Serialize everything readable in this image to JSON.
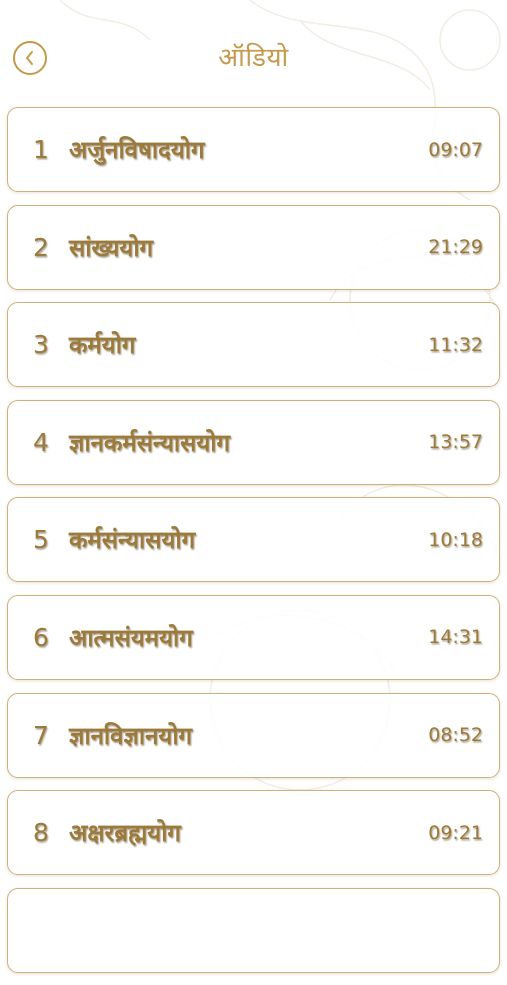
{
  "header": {
    "title": "ऑडियो",
    "back_icon": "chevron-left-icon"
  },
  "colors": {
    "accent": "#c49a4c",
    "card_border": "#cdb27b",
    "text": "#9c7a3c"
  },
  "tracks": [
    {
      "number": "1",
      "name": "अर्जुनविषादयोग",
      "duration": "09:07"
    },
    {
      "number": "2",
      "name": "सांख्ययोग",
      "duration": "21:29"
    },
    {
      "number": "3",
      "name": "कर्मयोग",
      "duration": "11:32"
    },
    {
      "number": "4",
      "name": "ज्ञानकर्मसंन्यासयोग",
      "duration": "13:57"
    },
    {
      "number": "5",
      "name": "कर्मसंन्यासयोग",
      "duration": "10:18"
    },
    {
      "number": "6",
      "name": "आत्मसंयमयोग",
      "duration": "14:31"
    },
    {
      "number": "7",
      "name": "ज्ञानविज्ञानयोग",
      "duration": "08:52"
    },
    {
      "number": "8",
      "name": "अक्षरब्रह्मयोग",
      "duration": "09:21"
    }
  ]
}
